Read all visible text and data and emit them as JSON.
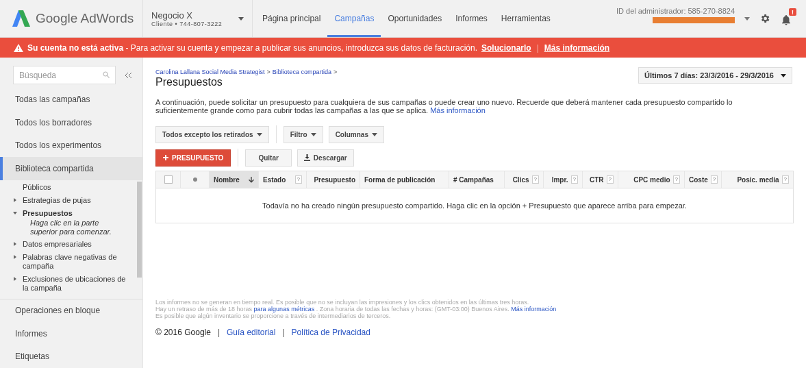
{
  "header": {
    "logo": "Google AdWords",
    "account": {
      "name": "Negocio X",
      "role": "Cliente",
      "separator": "•",
      "phone": "744-807-3222"
    },
    "nav": [
      {
        "label": "Página principal",
        "selected": false
      },
      {
        "label": "Campañas",
        "selected": true
      },
      {
        "label": "Oportunidades",
        "selected": false
      },
      {
        "label": "Informes",
        "selected": false
      },
      {
        "label": "Herramientas",
        "selected": false
      }
    ],
    "admin_id": "ID del administrador: 585-270-8824",
    "notification_badge": "!"
  },
  "banner": {
    "title": "Su cuenta no está activa",
    "message": " - Para activar su cuenta y empezar a publicar sus anuncios, introduzca sus datos de facturación.",
    "links": [
      "Solucionarlo",
      "Más información"
    ],
    "separator": "|"
  },
  "sidebar": {
    "search": {
      "placeholder": "Búsqueda"
    },
    "items": [
      {
        "label": "Todas las campañas",
        "selected": false
      },
      {
        "label": "Todos los borradores",
        "selected": false
      },
      {
        "label": "Todos los experimentos",
        "selected": false
      },
      {
        "label": "Biblioteca compartida",
        "selected": true,
        "children": [
          {
            "label": "Públicos",
            "selected": false
          },
          {
            "label": "Estrategias de pujas",
            "selected": false,
            "expanded": false
          },
          {
            "label": "Presupuestos",
            "selected": true,
            "expanded": true,
            "note": "Haga clic en la parte superior para comenzar."
          },
          {
            "label": "Datos empresariales",
            "selected": false,
            "expanded": false
          },
          {
            "label": "Palabras clave negativas de campaña",
            "selected": false,
            "expanded": false
          },
          {
            "label": "Exclusiones de ubicaciones de la campaña",
            "selected": false,
            "expanded": false
          }
        ]
      },
      {
        "label": "Operaciones en bloque",
        "selected": false
      },
      {
        "label": "Informes",
        "selected": false
      },
      {
        "label": "Etiquetas",
        "selected": false
      }
    ]
  },
  "breadcrumb": {
    "items": [
      "Carolina Lallana Social Media Strategist",
      "Biblioteca compartida"
    ],
    "separator": ">"
  },
  "page_title": "Presupuestos",
  "date_range": "Últimos 7 días: 23/3/2016 - 29/3/2016",
  "intro": {
    "text": "A continuación, puede solicitar un presupuesto para cualquiera de sus campañas o puede crear uno nuevo. Recuerde que deberá mantener cada presupuesto compartido lo suficientemente grande como para cubrir todas las campañas a las que se aplica.",
    "link": "Más información"
  },
  "filters": [
    "Todos excepto los retirados",
    "Filtro",
    "Columnas"
  ],
  "actions": {
    "primary": "PRESUPUESTO",
    "remove": "Quitar",
    "download": "Descargar"
  },
  "table": {
    "columns": [
      {
        "kind": "checkbox",
        "checked": false
      },
      {
        "kind": "status"
      },
      {
        "kind": "label",
        "label": "Nombre",
        "sorted": true
      },
      {
        "kind": "label",
        "label": "Estado",
        "sorted": false,
        "help": "?"
      },
      {
        "kind": "metric",
        "label": "Presupuesto",
        "sorted": false
      },
      {
        "kind": "label",
        "label": "Forma de publicación",
        "sorted": false
      },
      {
        "kind": "label",
        "label": "# Campañas",
        "sorted": false
      },
      {
        "kind": "metric",
        "label": "Clics",
        "sorted": false,
        "help": "?"
      },
      {
        "kind": "metric",
        "label": "Impr.",
        "sorted": false,
        "help": "?"
      },
      {
        "kind": "metric",
        "label": "CTR",
        "sorted": false,
        "help": "?"
      },
      {
        "kind": "metric",
        "label": "CPC medio",
        "sorted": false,
        "help": "?"
      },
      {
        "kind": "metric",
        "label": "Coste",
        "sorted": false,
        "help": "?"
      },
      {
        "kind": "metric",
        "label": "Posic. media",
        "sorted": false,
        "help": "?"
      }
    ],
    "empty_message": "Todavía no ha creado ningún presupuesto compartido. Haga clic en la opción + Presupuesto que aparece arriba para empezar."
  },
  "notes": [
    [
      {
        "text": "Los informes no se generan en tiempo real. Es posible que no se incluyan las impresiones y los clics obtenidos en las últimas tres horas.",
        "kind": "text"
      }
    ],
    [
      {
        "text": "Hay un retraso de más de 18 horas",
        "kind": "text"
      },
      {
        "text": "para algunas métricas",
        "kind": "link"
      },
      {
        "text": ". Zona horaria de todas las fechas y horas: (GMT-03:00) Buenos Aires.",
        "kind": "text"
      },
      {
        "text": "Más información",
        "kind": "link"
      }
    ],
    [
      {
        "text": "Es posible que algún inventario se proporcione a través de intermediarios de terceros.",
        "kind": "text"
      }
    ]
  ],
  "footer": {
    "copyright": "© 2016 Google",
    "links": [
      "Guía editorial",
      "Política de Privacidad"
    ],
    "separator": "|"
  }
}
